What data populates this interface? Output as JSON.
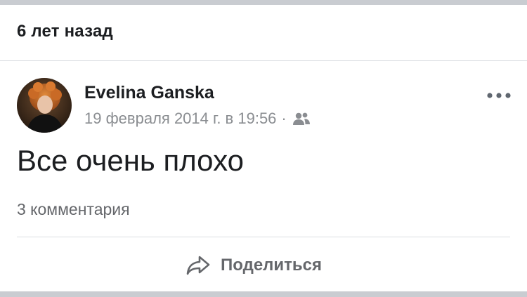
{
  "memory": {
    "title": "6 лет назад"
  },
  "post": {
    "author": "Evelina Ganska",
    "date": "19 февраля 2014 г. в 19:56",
    "meta_separator": "·",
    "audience_icon": "friends-icon",
    "more_icon": "more-horizontal-icon",
    "text": "Все очень плохо",
    "comments": "3 комментария"
  },
  "actions": {
    "share_icon": "share-arrow-icon",
    "share_label": "Поделиться"
  },
  "colors": {
    "background": "#ffffff",
    "separator_band": "#c9ccd1",
    "primary_text": "#1c1e21",
    "secondary_text": "#65676b",
    "meta_text": "#8a8d91"
  }
}
